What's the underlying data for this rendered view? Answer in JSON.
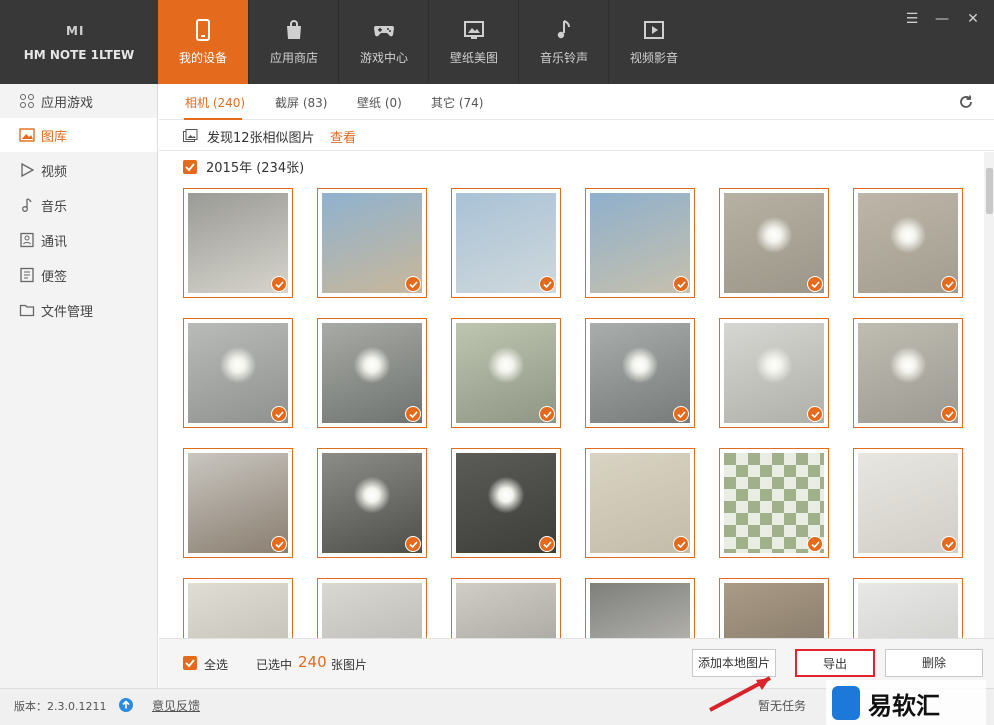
{
  "device": {
    "brand": "MI",
    "name": "HM NOTE 1LTEW"
  },
  "tabs": [
    {
      "label": "我的设备",
      "icon": "phone-icon",
      "active": true
    },
    {
      "label": "应用商店",
      "icon": "bag-icon",
      "active": false
    },
    {
      "label": "游戏中心",
      "icon": "gamepad-icon",
      "active": false
    },
    {
      "label": "壁纸美图",
      "icon": "picture-icon",
      "active": false
    },
    {
      "label": "音乐铃声",
      "icon": "music-note-icon",
      "active": false
    },
    {
      "label": "视频影音",
      "icon": "video-play-icon",
      "active": false
    }
  ],
  "window_controls": {
    "menu": "☰",
    "minimize": "—",
    "close": "✕"
  },
  "sidebar": {
    "items": [
      {
        "label": "应用游戏",
        "icon": "apps-grid-icon",
        "active": false
      },
      {
        "label": "图库",
        "icon": "image-icon",
        "active": true
      },
      {
        "label": "视频",
        "icon": "play-icon",
        "active": false
      },
      {
        "label": "音乐",
        "icon": "music-icon",
        "active": false
      },
      {
        "label": "通讯",
        "icon": "contacts-icon",
        "active": false
      },
      {
        "label": "便签",
        "icon": "note-icon",
        "active": false
      },
      {
        "label": "文件管理",
        "icon": "folder-icon",
        "active": false
      }
    ]
  },
  "subtabs": [
    {
      "label": "相机 (240)",
      "active": true
    },
    {
      "label": "截屏 (83)",
      "active": false
    },
    {
      "label": "壁纸 (0)",
      "active": false
    },
    {
      "label": "其它 (74)",
      "active": false
    }
  ],
  "similar": {
    "text": "发现12张相似图片",
    "link": "查看"
  },
  "group": {
    "label": "2015年 (234张)",
    "checked": true
  },
  "photos": [
    {
      "subject": "corridor",
      "tone": [
        "#9a9a96",
        "#d6d4cc"
      ]
    },
    {
      "subject": "beach",
      "tone": [
        "#8fb2cf",
        "#c9b79a"
      ]
    },
    {
      "subject": "sea",
      "tone": [
        "#a9c2d6",
        "#cfd8dc"
      ]
    },
    {
      "subject": "sea",
      "tone": [
        "#8fb0cc",
        "#c6c0ad"
      ]
    },
    {
      "subject": "ceiling-light",
      "tone": [
        "#b7b1a3",
        "#9c968a"
      ]
    },
    {
      "subject": "ceiling-light",
      "tone": [
        "#bdb6a8",
        "#a39d90"
      ]
    },
    {
      "subject": "pendant-lamp",
      "tone": [
        "#b9bbb8",
        "#8f928f"
      ]
    },
    {
      "subject": "round-lamp",
      "tone": [
        "#a8aba6",
        "#6f736f"
      ]
    },
    {
      "subject": "star-lamp",
      "tone": [
        "#bec5b0",
        "#8f9685"
      ]
    },
    {
      "subject": "ceiling-lamp",
      "tone": [
        "#a9adab",
        "#777b79"
      ]
    },
    {
      "subject": "wire-lamp",
      "tone": [
        "#d6d6d2",
        "#b0b0aa"
      ]
    },
    {
      "subject": "round-lamp",
      "tone": [
        "#bfbcb2",
        "#9d9a91"
      ]
    },
    {
      "subject": "room",
      "tone": [
        "#c9c6c0",
        "#8a7e70"
      ]
    },
    {
      "subject": "chandelier",
      "tone": [
        "#8c8c88",
        "#4e4e4a"
      ]
    },
    {
      "subject": "chandelier",
      "tone": [
        "#5b5b58",
        "#3d3d3a"
      ]
    },
    {
      "subject": "wall",
      "tone": [
        "#d9d3c3",
        "#c4bca9"
      ]
    },
    {
      "subject": "tiles",
      "tone": [
        "#c2cbb5",
        "#9fae8c"
      ]
    },
    {
      "subject": "document",
      "tone": [
        "#e8e6e0",
        "#d0cec7"
      ]
    },
    {
      "subject": "document",
      "tone": [
        "#e0ddd4",
        "#bcb9b0"
      ]
    },
    {
      "subject": "ceiling",
      "tone": [
        "#d9d8d3",
        "#b3b2ac"
      ]
    },
    {
      "subject": "interior",
      "tone": [
        "#cfcdc6",
        "#9e9c95"
      ]
    },
    {
      "subject": "doorway",
      "tone": [
        "#7e7e7a",
        "#c9c8c3"
      ]
    },
    {
      "subject": "shelf",
      "tone": [
        "#a99b86",
        "#7f7262"
      ]
    },
    {
      "subject": "wall",
      "tone": [
        "#e8e8e6",
        "#c9c9c6"
      ]
    }
  ],
  "footer": {
    "select_all": "全选",
    "selected_prefix": "已选中",
    "selected_count": "240",
    "selected_suffix": "张图片",
    "add_btn": "添加本地图片",
    "export_btn": "导出",
    "delete_btn": "删除"
  },
  "status": {
    "version": "版本：2.3.0.1211",
    "feedback": "意见反馈",
    "task": "暂无任务"
  },
  "watermark": {
    "text": "易软汇"
  },
  "colors": {
    "accent": "#e46a1d",
    "topbar": "#383838",
    "highlight": "#e4222b"
  }
}
